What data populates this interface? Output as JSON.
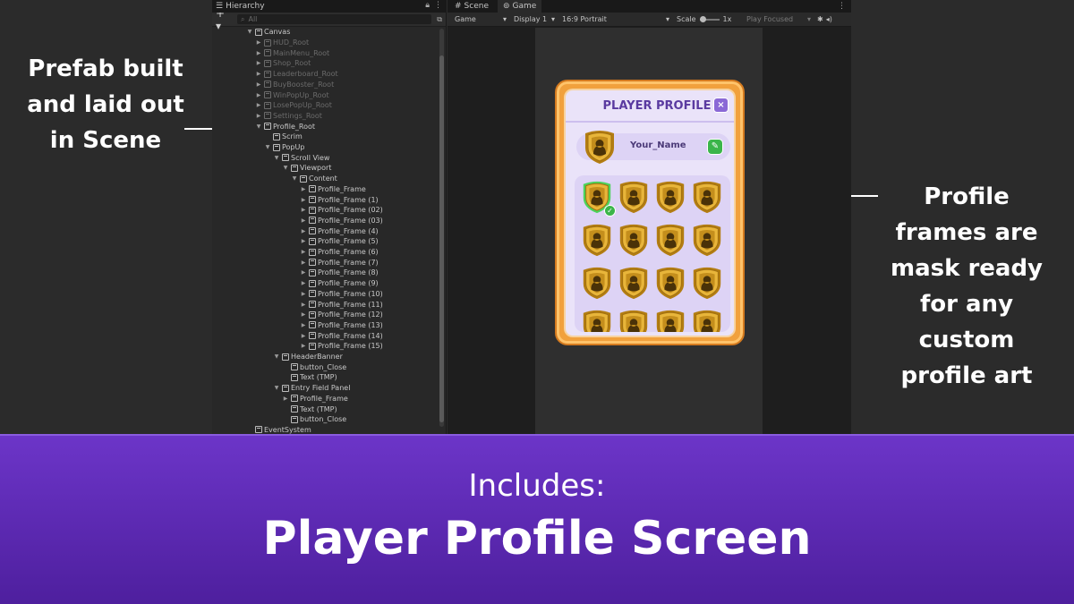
{
  "callouts": {
    "left": [
      "Prefab built",
      "and laid out",
      "in Scene"
    ],
    "right": [
      "Profile",
      "frames are",
      "mask ready",
      "for any",
      "custom",
      "profile art"
    ]
  },
  "hierarchy": {
    "tab_label": "Hierarchy",
    "add_label": "+ ▾",
    "search_placeholder": "All",
    "items": [
      {
        "label": "Canvas",
        "dim": false
      },
      {
        "label": "HUD_Root",
        "dim": true
      },
      {
        "label": "MainMenu_Root",
        "dim": true
      },
      {
        "label": "Shop_Root",
        "dim": true
      },
      {
        "label": "Leaderboard_Root",
        "dim": true
      },
      {
        "label": "BuyBooster_Root",
        "dim": true
      },
      {
        "label": "WinPopUp_Root",
        "dim": true
      },
      {
        "label": "LosePopUp_Root",
        "dim": true
      },
      {
        "label": "Settings_Root",
        "dim": true
      },
      {
        "label": "Profile_Root",
        "dim": false
      },
      {
        "label": "Scrim",
        "dim": false
      },
      {
        "label": "PopUp",
        "dim": false
      },
      {
        "label": "Scroll View",
        "dim": false
      },
      {
        "label": "Viewport",
        "dim": false
      },
      {
        "label": "Content",
        "dim": false
      },
      {
        "label": "Profile_Frame",
        "dim": false
      },
      {
        "label": "Profile_Frame (1)",
        "dim": false
      },
      {
        "label": "Profile_Frame (02)",
        "dim": false
      },
      {
        "label": "Profile_Frame (03)",
        "dim": false
      },
      {
        "label": "Profile_Frame (4)",
        "dim": false
      },
      {
        "label": "Profile_Frame (5)",
        "dim": false
      },
      {
        "label": "Profile_Frame (6)",
        "dim": false
      },
      {
        "label": "Profile_Frame (7)",
        "dim": false
      },
      {
        "label": "Profile_Frame (8)",
        "dim": false
      },
      {
        "label": "Profile_Frame (9)",
        "dim": false
      },
      {
        "label": "Profile_Frame (10)",
        "dim": false
      },
      {
        "label": "Profile_Frame (11)",
        "dim": false
      },
      {
        "label": "Profile_Frame (12)",
        "dim": false
      },
      {
        "label": "Profile_Frame (13)",
        "dim": false
      },
      {
        "label": "Profile_Frame (14)",
        "dim": false
      },
      {
        "label": "Profile_Frame (15)",
        "dim": false
      },
      {
        "label": "HeaderBanner",
        "dim": false
      },
      {
        "label": "button_Close",
        "dim": false
      },
      {
        "label": "Text (TMP)",
        "dim": false
      },
      {
        "label": "Entry Field Panel",
        "dim": false
      },
      {
        "label": "Profile_Frame",
        "dim": false
      },
      {
        "label": "Text (TMP)",
        "dim": false
      },
      {
        "label": "button_Close",
        "dim": false
      },
      {
        "label": "EventSystem",
        "dim": false
      }
    ]
  },
  "gameview": {
    "tabs": [
      "Scene",
      "Game"
    ],
    "toolbar": {
      "mode": "Game",
      "display": "Display 1",
      "aspect": "16:9 Portrait",
      "scale_label": "Scale",
      "scale_value": "1x",
      "play_mode": "Play Focused"
    }
  },
  "profile": {
    "title": "PLAYER PROFILE",
    "close_label": "×",
    "name": "Your_Name",
    "edit_label": "✎",
    "selected_frame_index": 0
  },
  "banner": {
    "subtitle": "Includes:",
    "title": "Player Profile Screen"
  },
  "colors": {
    "banner_top": "#6c35c8",
    "card_orange": "#f1a13d",
    "card_purple": "#5a3aa0",
    "frame_gold": "#d9a520",
    "selected_green": "#3bb54a"
  }
}
